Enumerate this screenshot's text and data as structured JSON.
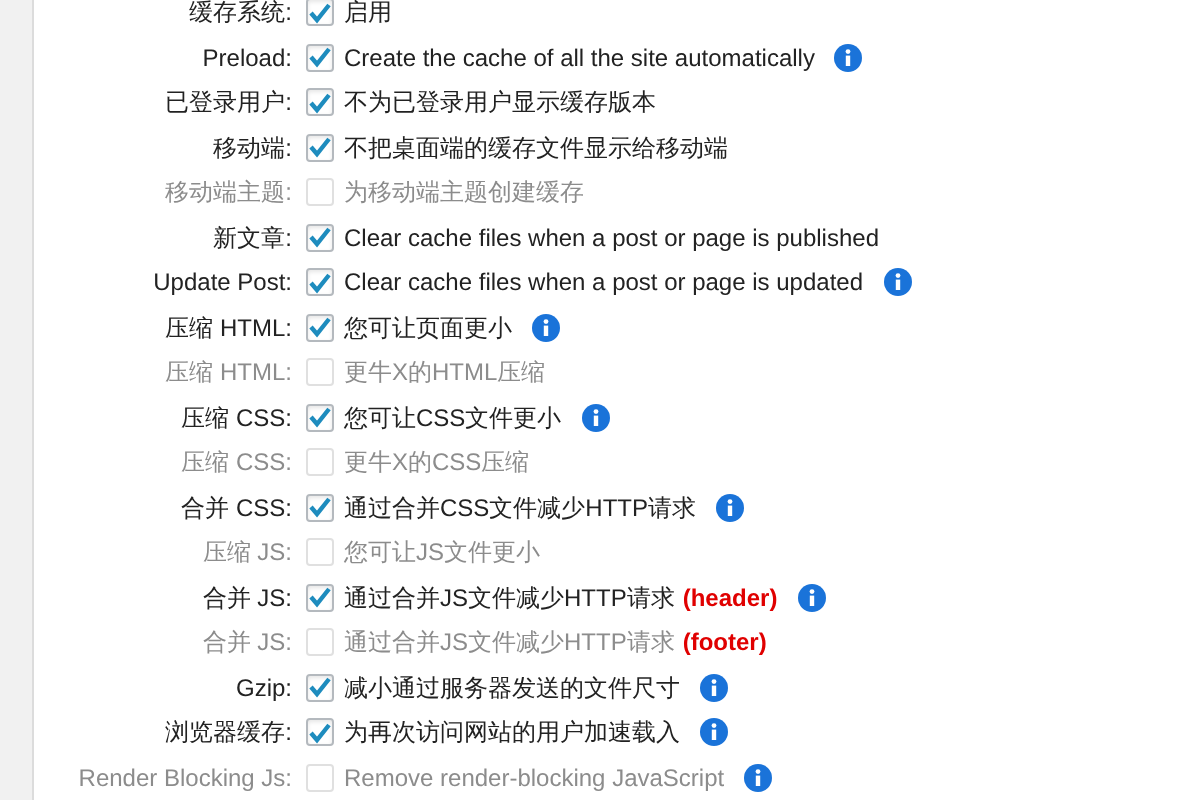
{
  "settings": [
    {
      "label": "缓存系统:",
      "checked": true,
      "disabled": false,
      "description": "启用",
      "info": false
    },
    {
      "label": "Preload:",
      "checked": true,
      "disabled": false,
      "description": "Create the cache of all the site automatically",
      "info": true
    },
    {
      "label": "已登录用户:",
      "checked": true,
      "disabled": false,
      "description": "不为已登录用户显示缓存版本",
      "info": false
    },
    {
      "label": "移动端:",
      "checked": true,
      "disabled": false,
      "description": "不把桌面端的缓存文件显示给移动端",
      "info": false
    },
    {
      "label": "移动端主题:",
      "checked": false,
      "disabled": true,
      "description": "为移动端主题创建缓存",
      "info": false
    },
    {
      "label": "新文章:",
      "checked": true,
      "disabled": false,
      "description": "Clear cache files when a post or page is published",
      "info": false
    },
    {
      "label": "Update Post:",
      "checked": true,
      "disabled": false,
      "description": "Clear cache files when a post or page is updated",
      "info": true
    },
    {
      "label": "压缩 HTML:",
      "checked": true,
      "disabled": false,
      "description": "您可让页面更小",
      "info": true
    },
    {
      "label": "压缩 HTML:",
      "checked": false,
      "disabled": true,
      "description": "更牛X的HTML压缩",
      "info": false
    },
    {
      "label": "压缩 CSS:",
      "checked": true,
      "disabled": false,
      "description": "您可让CSS文件更小",
      "info": true
    },
    {
      "label": "压缩 CSS:",
      "checked": false,
      "disabled": true,
      "description": "更牛X的CSS压缩",
      "info": false
    },
    {
      "label": "合并 CSS:",
      "checked": true,
      "disabled": false,
      "description": "通过合并CSS文件减少HTTP请求",
      "info": true
    },
    {
      "label": "压缩 JS:",
      "checked": false,
      "disabled": true,
      "description": "您可让JS文件更小",
      "info": false
    },
    {
      "label": "合并 JS:",
      "checked": true,
      "disabled": false,
      "description": "通过合并JS文件减少HTTP请求",
      "tag": "(header)",
      "info": true
    },
    {
      "label": "合并 JS:",
      "checked": false,
      "disabled": true,
      "description": "通过合并JS文件减少HTTP请求",
      "tag": "(footer)",
      "info": false
    },
    {
      "label": "Gzip:",
      "checked": true,
      "disabled": false,
      "description": "减小通过服务器发送的文件尺寸",
      "info": true
    },
    {
      "label": "浏览器缓存:",
      "checked": true,
      "disabled": false,
      "description": "为再次访问网站的用户加速载入",
      "info": true
    },
    {
      "label": "Render Blocking Js:",
      "checked": false,
      "disabled": true,
      "description": "Remove render-blocking JavaScript",
      "info": true
    }
  ]
}
